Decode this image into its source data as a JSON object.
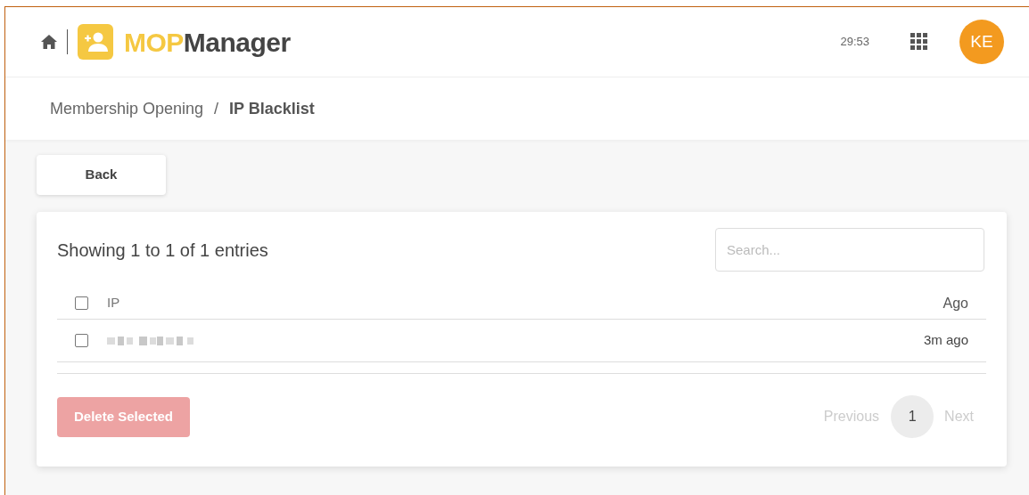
{
  "header": {
    "brand_highlight": "MOP",
    "brand_rest": "Manager",
    "timer": "29:53",
    "avatar": "KE"
  },
  "breadcrumb": [
    "Membership Opening",
    "IP Blacklist"
  ],
  "breadcrumb_separator": "/",
  "back_button": "Back",
  "table": {
    "summary": "Showing 1 to 1 of 1 entries",
    "search": {
      "placeholder": "Search..."
    },
    "header_checked": false,
    "columns": [
      "IP",
      "Ago"
    ],
    "rows": [
      {
        "checked": false,
        "ago": "3m ago"
      }
    ]
  },
  "delete_button": {
    "label": "Delete Selected",
    "disabled": true
  },
  "pagination": {
    "previous": {
      "label": "Previous",
      "disabled": true
    },
    "pages": [
      {
        "label": "1",
        "selected": true
      }
    ],
    "next": {
      "label": "Next",
      "disabled": true
    }
  }
}
